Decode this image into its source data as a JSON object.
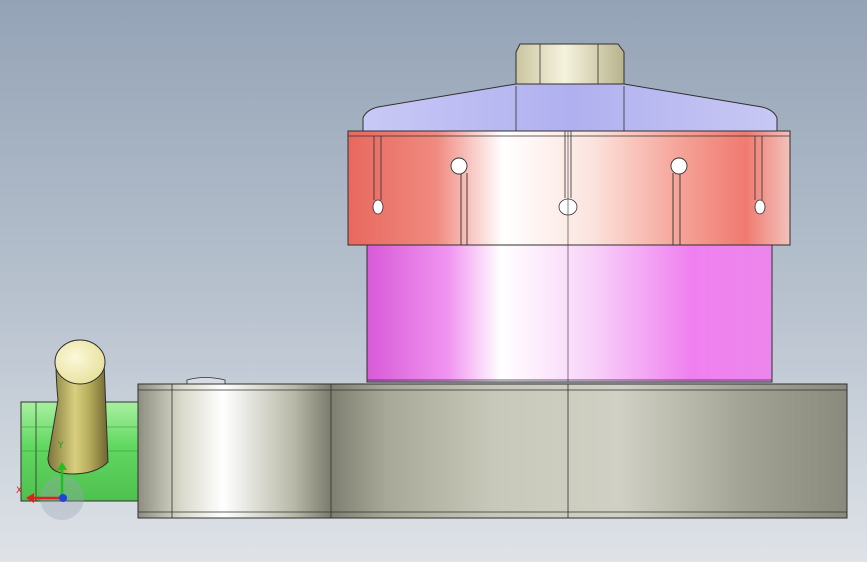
{
  "viewport": {
    "background_top": "#94a3b6",
    "background_bottom": "#dfe3e8"
  },
  "model": {
    "colors": {
      "nut": "#e8e4c4",
      "cap": "#b8b8f2",
      "collet_ring": "#f07a72",
      "body_cylinder": "#e874e8",
      "base_plate": "#c8c8b8",
      "handle": "#c8c070",
      "side_shaft": "#80e080",
      "edge": "#202020"
    }
  },
  "triad": {
    "x_label": "X",
    "y_label": "Y",
    "x_color": "#e02020",
    "y_color": "#20c020",
    "z_color": "#2040e0"
  }
}
